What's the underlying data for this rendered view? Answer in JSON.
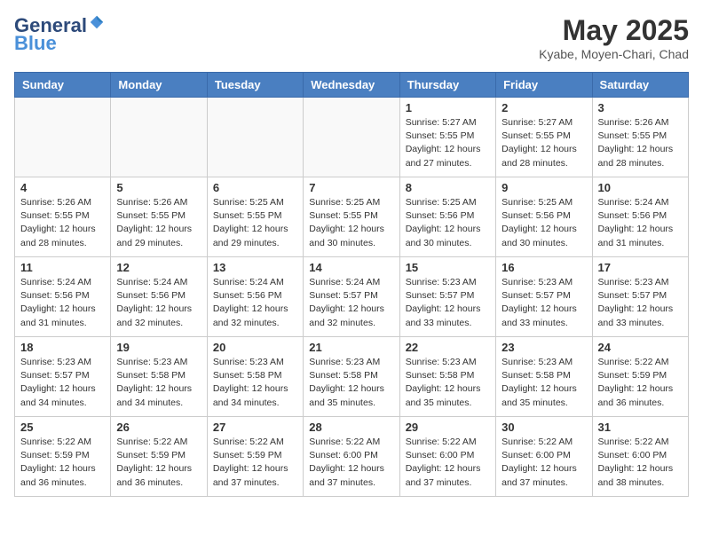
{
  "header": {
    "logo_general": "General",
    "logo_blue": "Blue",
    "month": "May 2025",
    "location": "Kyabe, Moyen-Chari, Chad"
  },
  "weekdays": [
    "Sunday",
    "Monday",
    "Tuesday",
    "Wednesday",
    "Thursday",
    "Friday",
    "Saturday"
  ],
  "weeks": [
    [
      {
        "day": "",
        "info": ""
      },
      {
        "day": "",
        "info": ""
      },
      {
        "day": "",
        "info": ""
      },
      {
        "day": "",
        "info": ""
      },
      {
        "day": "1",
        "info": "Sunrise: 5:27 AM\nSunset: 5:55 PM\nDaylight: 12 hours and 27 minutes."
      },
      {
        "day": "2",
        "info": "Sunrise: 5:27 AM\nSunset: 5:55 PM\nDaylight: 12 hours and 28 minutes."
      },
      {
        "day": "3",
        "info": "Sunrise: 5:26 AM\nSunset: 5:55 PM\nDaylight: 12 hours and 28 minutes."
      }
    ],
    [
      {
        "day": "4",
        "info": "Sunrise: 5:26 AM\nSunset: 5:55 PM\nDaylight: 12 hours and 28 minutes."
      },
      {
        "day": "5",
        "info": "Sunrise: 5:26 AM\nSunset: 5:55 PM\nDaylight: 12 hours and 29 minutes."
      },
      {
        "day": "6",
        "info": "Sunrise: 5:25 AM\nSunset: 5:55 PM\nDaylight: 12 hours and 29 minutes."
      },
      {
        "day": "7",
        "info": "Sunrise: 5:25 AM\nSunset: 5:55 PM\nDaylight: 12 hours and 30 minutes."
      },
      {
        "day": "8",
        "info": "Sunrise: 5:25 AM\nSunset: 5:56 PM\nDaylight: 12 hours and 30 minutes."
      },
      {
        "day": "9",
        "info": "Sunrise: 5:25 AM\nSunset: 5:56 PM\nDaylight: 12 hours and 30 minutes."
      },
      {
        "day": "10",
        "info": "Sunrise: 5:24 AM\nSunset: 5:56 PM\nDaylight: 12 hours and 31 minutes."
      }
    ],
    [
      {
        "day": "11",
        "info": "Sunrise: 5:24 AM\nSunset: 5:56 PM\nDaylight: 12 hours and 31 minutes."
      },
      {
        "day": "12",
        "info": "Sunrise: 5:24 AM\nSunset: 5:56 PM\nDaylight: 12 hours and 32 minutes."
      },
      {
        "day": "13",
        "info": "Sunrise: 5:24 AM\nSunset: 5:56 PM\nDaylight: 12 hours and 32 minutes."
      },
      {
        "day": "14",
        "info": "Sunrise: 5:24 AM\nSunset: 5:57 PM\nDaylight: 12 hours and 32 minutes."
      },
      {
        "day": "15",
        "info": "Sunrise: 5:23 AM\nSunset: 5:57 PM\nDaylight: 12 hours and 33 minutes."
      },
      {
        "day": "16",
        "info": "Sunrise: 5:23 AM\nSunset: 5:57 PM\nDaylight: 12 hours and 33 minutes."
      },
      {
        "day": "17",
        "info": "Sunrise: 5:23 AM\nSunset: 5:57 PM\nDaylight: 12 hours and 33 minutes."
      }
    ],
    [
      {
        "day": "18",
        "info": "Sunrise: 5:23 AM\nSunset: 5:57 PM\nDaylight: 12 hours and 34 minutes."
      },
      {
        "day": "19",
        "info": "Sunrise: 5:23 AM\nSunset: 5:58 PM\nDaylight: 12 hours and 34 minutes."
      },
      {
        "day": "20",
        "info": "Sunrise: 5:23 AM\nSunset: 5:58 PM\nDaylight: 12 hours and 34 minutes."
      },
      {
        "day": "21",
        "info": "Sunrise: 5:23 AM\nSunset: 5:58 PM\nDaylight: 12 hours and 35 minutes."
      },
      {
        "day": "22",
        "info": "Sunrise: 5:23 AM\nSunset: 5:58 PM\nDaylight: 12 hours and 35 minutes."
      },
      {
        "day": "23",
        "info": "Sunrise: 5:23 AM\nSunset: 5:58 PM\nDaylight: 12 hours and 35 minutes."
      },
      {
        "day": "24",
        "info": "Sunrise: 5:22 AM\nSunset: 5:59 PM\nDaylight: 12 hours and 36 minutes."
      }
    ],
    [
      {
        "day": "25",
        "info": "Sunrise: 5:22 AM\nSunset: 5:59 PM\nDaylight: 12 hours and 36 minutes."
      },
      {
        "day": "26",
        "info": "Sunrise: 5:22 AM\nSunset: 5:59 PM\nDaylight: 12 hours and 36 minutes."
      },
      {
        "day": "27",
        "info": "Sunrise: 5:22 AM\nSunset: 5:59 PM\nDaylight: 12 hours and 37 minutes."
      },
      {
        "day": "28",
        "info": "Sunrise: 5:22 AM\nSunset: 6:00 PM\nDaylight: 12 hours and 37 minutes."
      },
      {
        "day": "29",
        "info": "Sunrise: 5:22 AM\nSunset: 6:00 PM\nDaylight: 12 hours and 37 minutes."
      },
      {
        "day": "30",
        "info": "Sunrise: 5:22 AM\nSunset: 6:00 PM\nDaylight: 12 hours and 37 minutes."
      },
      {
        "day": "31",
        "info": "Sunrise: 5:22 AM\nSunset: 6:00 PM\nDaylight: 12 hours and 38 minutes."
      }
    ]
  ]
}
